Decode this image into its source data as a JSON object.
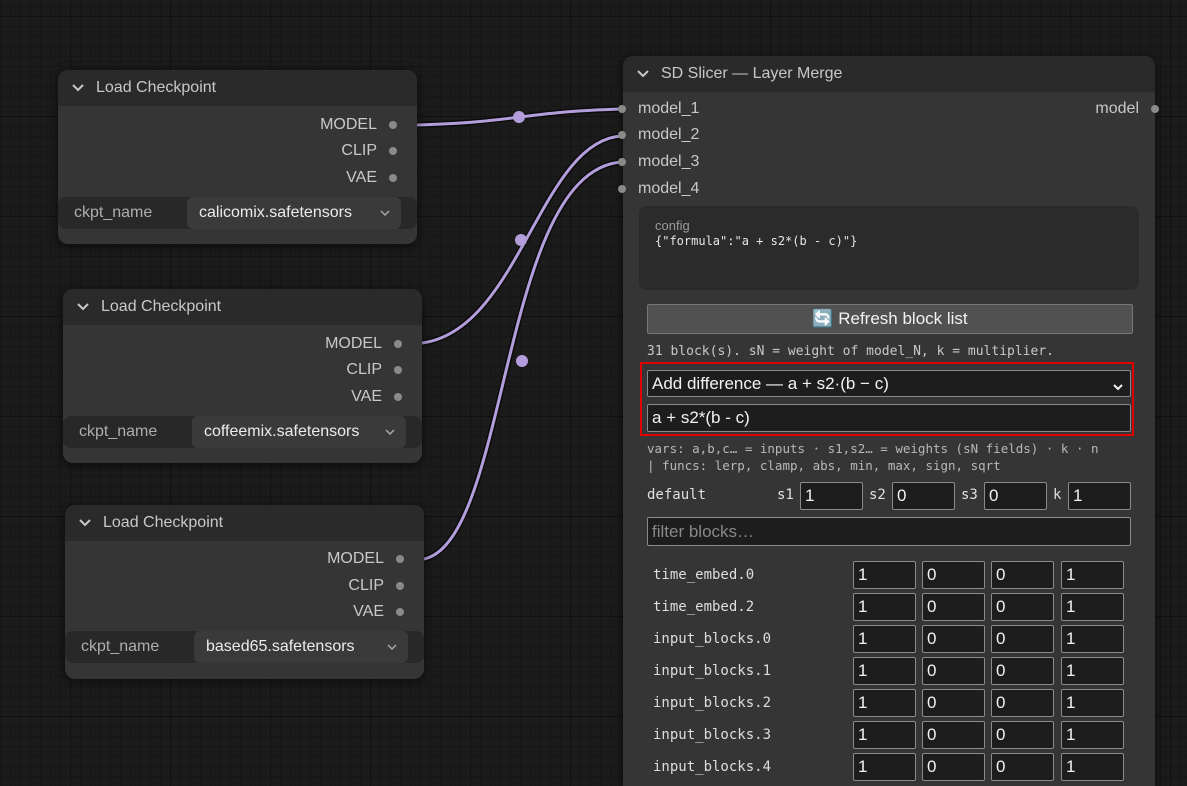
{
  "checkpoint_nodes": [
    {
      "title": "Load Checkpoint",
      "outputs": [
        "MODEL",
        "CLIP",
        "VAE"
      ],
      "widget_label": "ckpt_name",
      "widget_value": "calicomix.safetensors"
    },
    {
      "title": "Load Checkpoint",
      "outputs": [
        "MODEL",
        "CLIP",
        "VAE"
      ],
      "widget_label": "ckpt_name",
      "widget_value": "coffeemix.safetensors"
    },
    {
      "title": "Load Checkpoint",
      "outputs": [
        "MODEL",
        "CLIP",
        "VAE"
      ],
      "widget_label": "ckpt_name",
      "widget_value": "based65.safetensors"
    }
  ],
  "slicer": {
    "title": "SD Slicer — Layer Merge",
    "inputs": [
      "model_1",
      "model_2",
      "model_3",
      "model_4"
    ],
    "output": "model",
    "config_label": "config",
    "config_value": "{\"formula\":\"a + s2*(b - c)\"}",
    "refresh_label": "🔄 Refresh block list",
    "info": "31 block(s). sN = weight of model_N, k = multiplier.",
    "preset_selected": "Add difference — a + s2·(b − c)",
    "formula": "a + s2*(b - c)",
    "help_line1": "vars: a,b,c… = inputs · s1,s2… = weights (sN fields) · k · n",
    "help_line2": "| funcs: lerp, clamp, abs, min, max, sign, sqrt",
    "default_label": "default",
    "defaults": {
      "s1_label": "s1",
      "s1": "1",
      "s2_label": "s2",
      "s2": "0",
      "s3_label": "s3",
      "s3": "0",
      "k_label": "k",
      "k": "1"
    },
    "filter_placeholder": "filter blocks…",
    "blocks": [
      {
        "name": "time_embed.0",
        "s1": "1",
        "s2": "0",
        "s3": "0",
        "k": "1"
      },
      {
        "name": "time_embed.2",
        "s1": "1",
        "s2": "0",
        "s3": "0",
        "k": "1"
      },
      {
        "name": "input_blocks.0",
        "s1": "1",
        "s2": "0",
        "s3": "0",
        "k": "1"
      },
      {
        "name": "input_blocks.1",
        "s1": "1",
        "s2": "0",
        "s3": "0",
        "k": "1"
      },
      {
        "name": "input_blocks.2",
        "s1": "1",
        "s2": "0",
        "s3": "0",
        "k": "1"
      },
      {
        "name": "input_blocks.3",
        "s1": "1",
        "s2": "0",
        "s3": "0",
        "k": "1"
      },
      {
        "name": "input_blocks.4",
        "s1": "1",
        "s2": "0",
        "s3": "0",
        "k": "1"
      }
    ]
  },
  "colors": {
    "link": "#b39ddb",
    "highlight": "#e00000"
  }
}
